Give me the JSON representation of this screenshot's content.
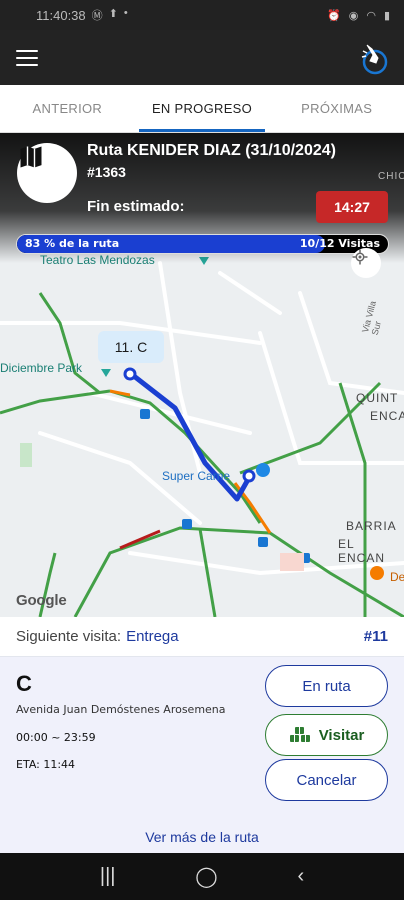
{
  "status_bar": {
    "time": "11:40:38",
    "left_icons": [
      "m-icon",
      "upload-icon",
      "dot-icon"
    ],
    "right_icons": [
      "alarm-icon",
      "location-icon",
      "wifi-icon",
      "battery-icon"
    ]
  },
  "app_bar": {
    "logo": "tap-hand-logo"
  },
  "tabs": [
    {
      "label": "ANTERIOR",
      "active": false
    },
    {
      "label": "EN PROGRESO",
      "active": true
    },
    {
      "label": "PRÓXIMAS",
      "active": false
    }
  ],
  "route": {
    "title": "Ruta KENIDER DIAZ (31/10/2024)",
    "id": "#1363",
    "eta_label": "Fin estimado:",
    "eta_time": "14:27",
    "progress_text": "83 % de la ruta",
    "progress_fraction": 0.83,
    "visits_text": "10/12 Visitas"
  },
  "map": {
    "stop_label": "11. C",
    "labels": {
      "park": "Diciembre Park",
      "mendozas": "Teatro Las Mendozas",
      "super": "Super Carne",
      "quint": "QUINT",
      "enca": "ENCA",
      "barria": "BARRIA",
      "el_encan": "EL ENCAN",
      "chic": "CHIC",
      "villa": "Via Villa Sur",
      "de": "De"
    },
    "google": "Google"
  },
  "next_visit": {
    "label": "Siguiente visita:",
    "type": "Entrega",
    "number": "#11"
  },
  "stop": {
    "name": "C",
    "address": "Avenida Juan Demóstenes Arosemena",
    "window": "00:00 ~ 23:59",
    "eta": "ETA: 11:44"
  },
  "buttons": {
    "en_ruta": "En ruta",
    "visitar": "Visitar",
    "cancelar": "Cancelar"
  },
  "more_link": "Ver más de la ruta",
  "colors": {
    "accent": "#1e3a9e",
    "route_line": "#1a3fd1",
    "eta_badge": "#c62828",
    "visit_green": "#2e7d32"
  }
}
